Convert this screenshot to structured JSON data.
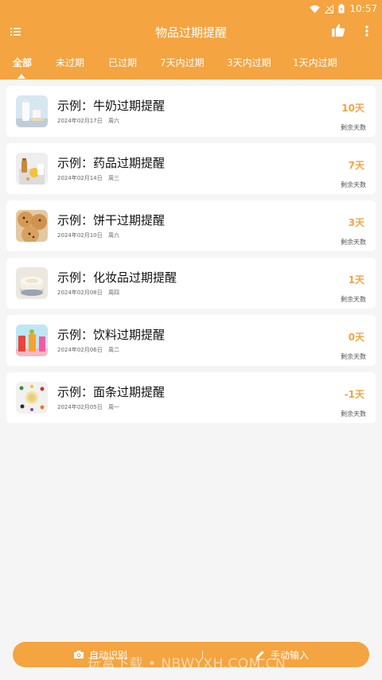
{
  "status_bar": {
    "time": "10:57"
  },
  "toolbar": {
    "title": "物品过期提醒"
  },
  "tabs": [
    {
      "label": "全部",
      "active": true
    },
    {
      "label": "未过期"
    },
    {
      "label": "已过期"
    },
    {
      "label": "7天内过期"
    },
    {
      "label": "3天内过期"
    },
    {
      "label": "1天内过期"
    }
  ],
  "items": [
    {
      "name": "示例：牛奶过期提醒",
      "date": "2024年02月17日",
      "weekday": "周六",
      "days": "10天",
      "days_label": "剩余天数",
      "icon": "milk-thumbnail"
    },
    {
      "name": "示例：药品过期提醒",
      "date": "2024年02月14日",
      "weekday": "周三",
      "days": "7天",
      "days_label": "剩余天数",
      "icon": "medicine-thumbnail"
    },
    {
      "name": "示例：饼干过期提醒",
      "date": "2024年02月10日",
      "weekday": "周六",
      "days": "3天",
      "days_label": "剩余天数",
      "icon": "cookie-thumbnail"
    },
    {
      "name": "示例：化妆品过期提醒",
      "date": "2024年02月08日",
      "weekday": "周四",
      "days": "1天",
      "days_label": "剩余天数",
      "icon": "cosmetics-thumbnail"
    },
    {
      "name": "示例：饮料过期提醒",
      "date": "2024年02月06日",
      "weekday": "周二",
      "days": "0天",
      "days_label": "剩余天数",
      "icon": "drinks-thumbnail"
    },
    {
      "name": "示例：面条过期提醒",
      "date": "2024年02月05日",
      "weekday": "周一",
      "days": "-1天",
      "days_label": "剩余天数",
      "icon": "noodles-thumbnail"
    }
  ],
  "bottom_bar": {
    "auto_label": "自动识别",
    "manual_label": "手动输入"
  },
  "watermark": "玩富下载 • NBWYXH.COM.CN",
  "colors": {
    "accent": "#f4a440",
    "background": "#f5f5f5",
    "card": "#ffffff"
  }
}
